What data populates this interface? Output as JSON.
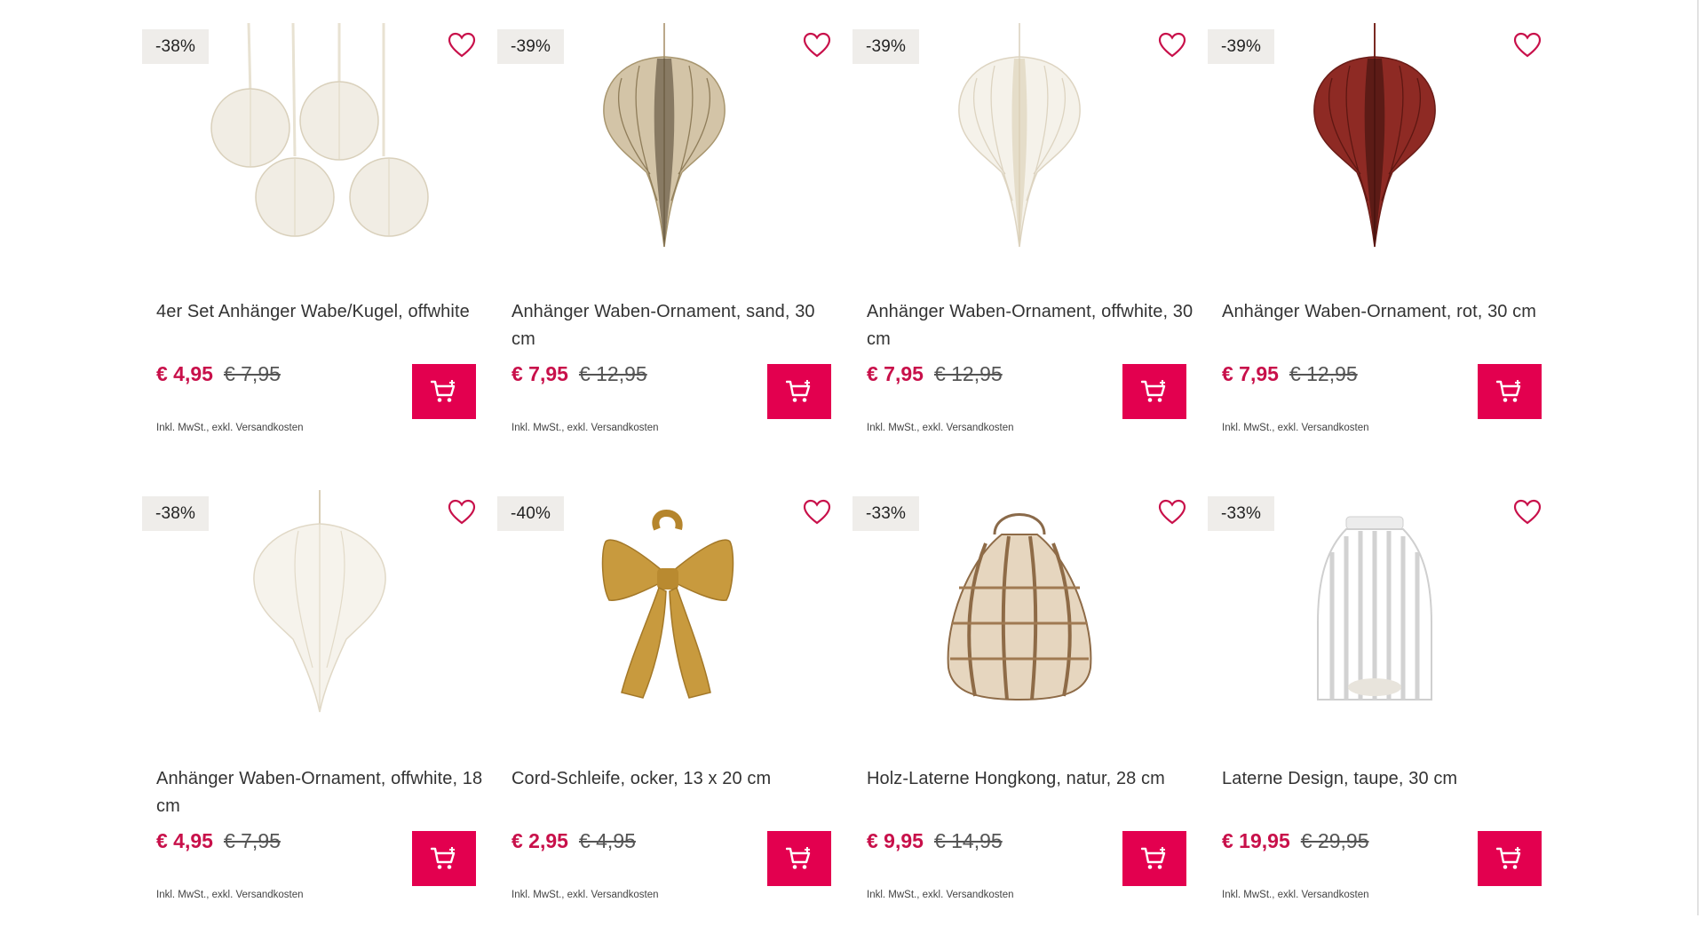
{
  "products": [
    {
      "discount": "-38%",
      "name": "4er Set Anhänger Wabe/Kugel, offwhite",
      "price": "€ 4,95",
      "old_price": "€ 7,95",
      "tax": "Inkl. MwSt., exkl. Versandkosten"
    },
    {
      "discount": "-39%",
      "name": "Anhänger Waben-Ornament, sand, 30 cm",
      "price": "€ 7,95",
      "old_price": "€ 12,95",
      "tax": "Inkl. MwSt., exkl. Versandkosten"
    },
    {
      "discount": "-39%",
      "name": "Anhänger Waben-Ornament, offwhite, 30 cm",
      "price": "€ 7,95",
      "old_price": "€ 12,95",
      "tax": "Inkl. MwSt., exkl. Versandkosten"
    },
    {
      "discount": "-39%",
      "name": "Anhänger Waben-Ornament, rot, 30 cm",
      "price": "€ 7,95",
      "old_price": "€ 12,95",
      "tax": "Inkl. MwSt., exkl. Versandkosten"
    },
    {
      "discount": "-38%",
      "name": "Anhänger Waben-Ornament, offwhite, 18 cm",
      "price": "€ 4,95",
      "old_price": "€ 7,95",
      "tax": "Inkl. MwSt., exkl. Versandkosten"
    },
    {
      "discount": "-40%",
      "name": "Cord-Schleife, ocker, 13 x 20 cm",
      "price": "€ 2,95",
      "old_price": "€ 4,95",
      "tax": "Inkl. MwSt., exkl. Versandkosten"
    },
    {
      "discount": "-33%",
      "name": "Holz-Laterne Hongkong, natur, 28 cm",
      "price": "€ 9,95",
      "old_price": "€ 14,95",
      "tax": "Inkl. MwSt., exkl. Versandkosten"
    },
    {
      "discount": "-33%",
      "name": "Laterne Design, taupe, 30 cm",
      "price": "€ 19,95",
      "old_price": "€ 29,95",
      "tax": "Inkl. MwSt., exkl. Versandkosten"
    }
  ],
  "icons": {
    "wishlist": "heart-outline-icon",
    "add_to_cart": "cart-plus-icon"
  },
  "colors": {
    "accent": "#e3004f",
    "sale_price": "#c8104a",
    "badge_bg": "#efedea"
  }
}
